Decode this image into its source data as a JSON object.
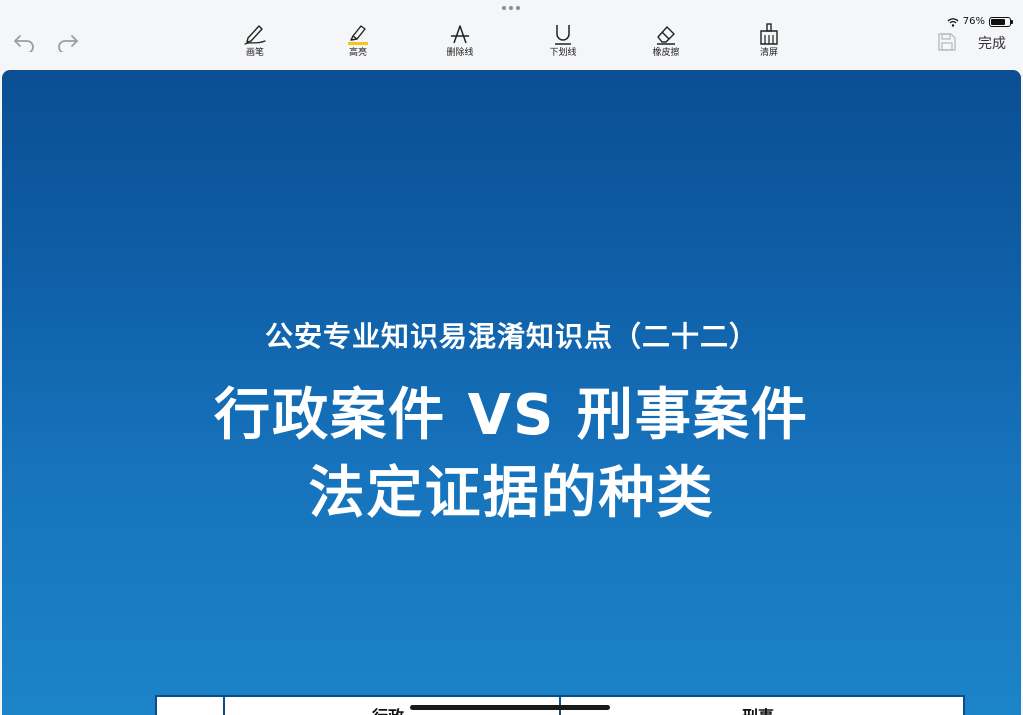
{
  "toolbar": {
    "tools": [
      {
        "label": "画笔",
        "icon": "pen-icon"
      },
      {
        "label": "高亮",
        "icon": "highlighter-icon"
      },
      {
        "label": "删除线",
        "icon": "strikethrough-icon"
      },
      {
        "label": "下划线",
        "icon": "underline-icon"
      },
      {
        "label": "橡皮擦",
        "icon": "eraser-icon"
      },
      {
        "label": "清屏",
        "icon": "clear-screen-icon"
      }
    ],
    "undo_icon": "undo-icon",
    "redo_icon": "redo-icon",
    "save_icon": "save-icon",
    "done_label": "完成",
    "highlight_color": "#f5c518"
  },
  "status": {
    "battery_percent": "76%",
    "battery_level": 0.76,
    "wifi_icon": "wifi-icon"
  },
  "slide": {
    "subtitle": "公安专业知识易混淆知识点（二十二）",
    "title_line1": "行政案件 VS 刑事案件",
    "title_line2": "法定证据的种类",
    "background_top": "#0b4e93",
    "background_bottom": "#1c84c9"
  },
  "table": {
    "headers": [
      "行政",
      "刑事"
    ]
  }
}
